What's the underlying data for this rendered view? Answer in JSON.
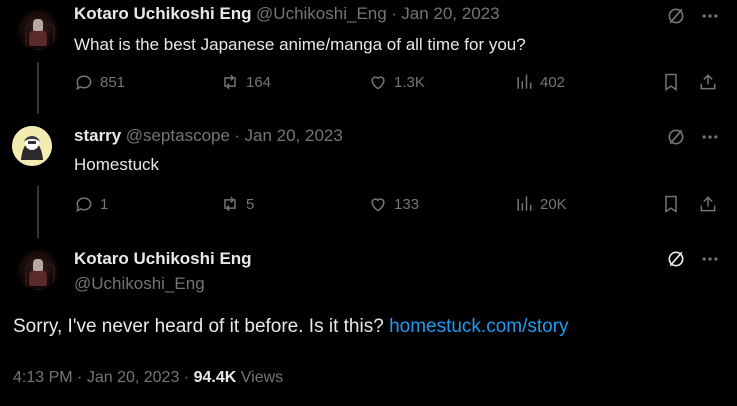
{
  "tweet1": {
    "name": "Kotaro Uchikoshi Eng",
    "handle": "@Uchikoshi_Eng",
    "date": "Jan 20, 2023",
    "text": "What is the best Japanese anime/manga of all time for you?",
    "replies": "851",
    "retweets": "164",
    "likes": "1.3K",
    "views": "402"
  },
  "tweet2": {
    "name": "starry",
    "handle": "@septascope",
    "date": "Jan 20, 2023",
    "text": "Homestuck",
    "replies": "1",
    "retweets": "5",
    "likes": "133",
    "views": "20K"
  },
  "tweet3": {
    "name": "Kotaro Uchikoshi Eng",
    "handle": "@Uchikoshi_Eng",
    "text_prefix": "Sorry, I've never heard of it before. Is it this?",
    "link": "homestuck.com/story",
    "time": "4:13 PM",
    "date": "Jan 20, 2023",
    "views_count": "94.4K",
    "views_label": "Views"
  },
  "separator": "·",
  "icons": [
    "slash-circle-icon",
    "more-icon",
    "reply-icon",
    "retweet-icon",
    "like-icon",
    "views-icon",
    "bookmark-icon",
    "share-icon"
  ],
  "colors": {
    "background": "#000000",
    "text": "#e7e9ea",
    "muted": "#71767b",
    "link": "#1d9bf0"
  }
}
